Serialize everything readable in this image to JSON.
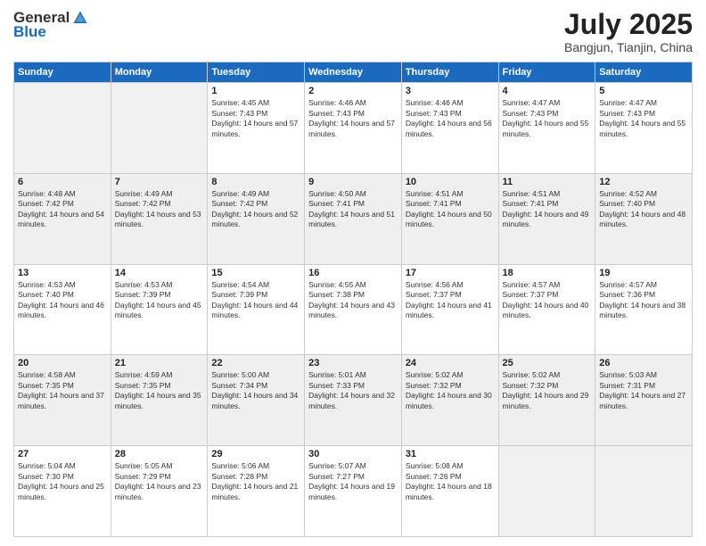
{
  "header": {
    "logo_general": "General",
    "logo_blue": "Blue",
    "title": "July 2025",
    "subtitle": "Bangjun, Tianjin, China"
  },
  "weekdays": [
    "Sunday",
    "Monday",
    "Tuesday",
    "Wednesday",
    "Thursday",
    "Friday",
    "Saturday"
  ],
  "weeks": [
    [
      {
        "day": "",
        "info": ""
      },
      {
        "day": "",
        "info": ""
      },
      {
        "day": "1",
        "info": "Sunrise: 4:45 AM\nSunset: 7:43 PM\nDaylight: 14 hours and 57 minutes."
      },
      {
        "day": "2",
        "info": "Sunrise: 4:46 AM\nSunset: 7:43 PM\nDaylight: 14 hours and 57 minutes."
      },
      {
        "day": "3",
        "info": "Sunrise: 4:46 AM\nSunset: 7:43 PM\nDaylight: 14 hours and 56 minutes."
      },
      {
        "day": "4",
        "info": "Sunrise: 4:47 AM\nSunset: 7:43 PM\nDaylight: 14 hours and 55 minutes."
      },
      {
        "day": "5",
        "info": "Sunrise: 4:47 AM\nSunset: 7:43 PM\nDaylight: 14 hours and 55 minutes."
      }
    ],
    [
      {
        "day": "6",
        "info": "Sunrise: 4:48 AM\nSunset: 7:42 PM\nDaylight: 14 hours and 54 minutes."
      },
      {
        "day": "7",
        "info": "Sunrise: 4:49 AM\nSunset: 7:42 PM\nDaylight: 14 hours and 53 minutes."
      },
      {
        "day": "8",
        "info": "Sunrise: 4:49 AM\nSunset: 7:42 PM\nDaylight: 14 hours and 52 minutes."
      },
      {
        "day": "9",
        "info": "Sunrise: 4:50 AM\nSunset: 7:41 PM\nDaylight: 14 hours and 51 minutes."
      },
      {
        "day": "10",
        "info": "Sunrise: 4:51 AM\nSunset: 7:41 PM\nDaylight: 14 hours and 50 minutes."
      },
      {
        "day": "11",
        "info": "Sunrise: 4:51 AM\nSunset: 7:41 PM\nDaylight: 14 hours and 49 minutes."
      },
      {
        "day": "12",
        "info": "Sunrise: 4:52 AM\nSunset: 7:40 PM\nDaylight: 14 hours and 48 minutes."
      }
    ],
    [
      {
        "day": "13",
        "info": "Sunrise: 4:53 AM\nSunset: 7:40 PM\nDaylight: 14 hours and 46 minutes."
      },
      {
        "day": "14",
        "info": "Sunrise: 4:53 AM\nSunset: 7:39 PM\nDaylight: 14 hours and 45 minutes."
      },
      {
        "day": "15",
        "info": "Sunrise: 4:54 AM\nSunset: 7:39 PM\nDaylight: 14 hours and 44 minutes."
      },
      {
        "day": "16",
        "info": "Sunrise: 4:55 AM\nSunset: 7:38 PM\nDaylight: 14 hours and 43 minutes."
      },
      {
        "day": "17",
        "info": "Sunrise: 4:56 AM\nSunset: 7:37 PM\nDaylight: 14 hours and 41 minutes."
      },
      {
        "day": "18",
        "info": "Sunrise: 4:57 AM\nSunset: 7:37 PM\nDaylight: 14 hours and 40 minutes."
      },
      {
        "day": "19",
        "info": "Sunrise: 4:57 AM\nSunset: 7:36 PM\nDaylight: 14 hours and 38 minutes."
      }
    ],
    [
      {
        "day": "20",
        "info": "Sunrise: 4:58 AM\nSunset: 7:35 PM\nDaylight: 14 hours and 37 minutes."
      },
      {
        "day": "21",
        "info": "Sunrise: 4:59 AM\nSunset: 7:35 PM\nDaylight: 14 hours and 35 minutes."
      },
      {
        "day": "22",
        "info": "Sunrise: 5:00 AM\nSunset: 7:34 PM\nDaylight: 14 hours and 34 minutes."
      },
      {
        "day": "23",
        "info": "Sunrise: 5:01 AM\nSunset: 7:33 PM\nDaylight: 14 hours and 32 minutes."
      },
      {
        "day": "24",
        "info": "Sunrise: 5:02 AM\nSunset: 7:32 PM\nDaylight: 14 hours and 30 minutes."
      },
      {
        "day": "25",
        "info": "Sunrise: 5:02 AM\nSunset: 7:32 PM\nDaylight: 14 hours and 29 minutes."
      },
      {
        "day": "26",
        "info": "Sunrise: 5:03 AM\nSunset: 7:31 PM\nDaylight: 14 hours and 27 minutes."
      }
    ],
    [
      {
        "day": "27",
        "info": "Sunrise: 5:04 AM\nSunset: 7:30 PM\nDaylight: 14 hours and 25 minutes."
      },
      {
        "day": "28",
        "info": "Sunrise: 5:05 AM\nSunset: 7:29 PM\nDaylight: 14 hours and 23 minutes."
      },
      {
        "day": "29",
        "info": "Sunrise: 5:06 AM\nSunset: 7:28 PM\nDaylight: 14 hours and 21 minutes."
      },
      {
        "day": "30",
        "info": "Sunrise: 5:07 AM\nSunset: 7:27 PM\nDaylight: 14 hours and 19 minutes."
      },
      {
        "day": "31",
        "info": "Sunrise: 5:08 AM\nSunset: 7:26 PM\nDaylight: 14 hours and 18 minutes."
      },
      {
        "day": "",
        "info": ""
      },
      {
        "day": "",
        "info": ""
      }
    ]
  ]
}
